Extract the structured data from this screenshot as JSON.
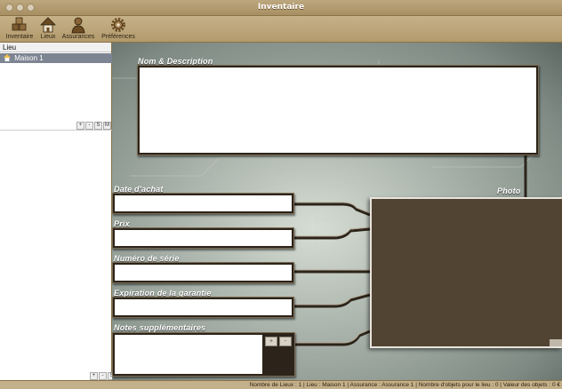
{
  "window": {
    "title": "Inventaire"
  },
  "toolbar": {
    "items": [
      {
        "label": "Inventaire",
        "icon": "boxes-icon"
      },
      {
        "label": "Lieux",
        "icon": "house-icon"
      },
      {
        "label": "Assurances",
        "icon": "person-icon"
      },
      {
        "label": "Préférences",
        "icon": "gear-icon"
      }
    ]
  },
  "sidebar": {
    "header": "Lieu",
    "items": [
      {
        "label": "Maison 1",
        "selected": true
      }
    ],
    "mini_buttons": [
      "+",
      "-",
      "S",
      "M"
    ],
    "bottom_buttons": [
      "+",
      "-",
      "S"
    ]
  },
  "form": {
    "name_desc_label": "Nom & Description",
    "date_label": "Date d'achat",
    "price_label": "Prix",
    "serial_label": "Numéro de série",
    "warranty_label": "Expiration de la garantie",
    "notes_label": "Notes supplémentaires",
    "photo_label": "Photo",
    "notes_buttons": [
      "+",
      "-"
    ]
  },
  "status": {
    "text": "Nombre de Lieux : 1 | Lieu : Maison 1 | Assurance : Assurance 1 | Nombre d'objets pour le lieu : 0 | Valeur des objets : 0 €"
  },
  "colors": {
    "accent": "#b29a6c",
    "selection": "#7e8592",
    "photo_bg": "#524433"
  }
}
